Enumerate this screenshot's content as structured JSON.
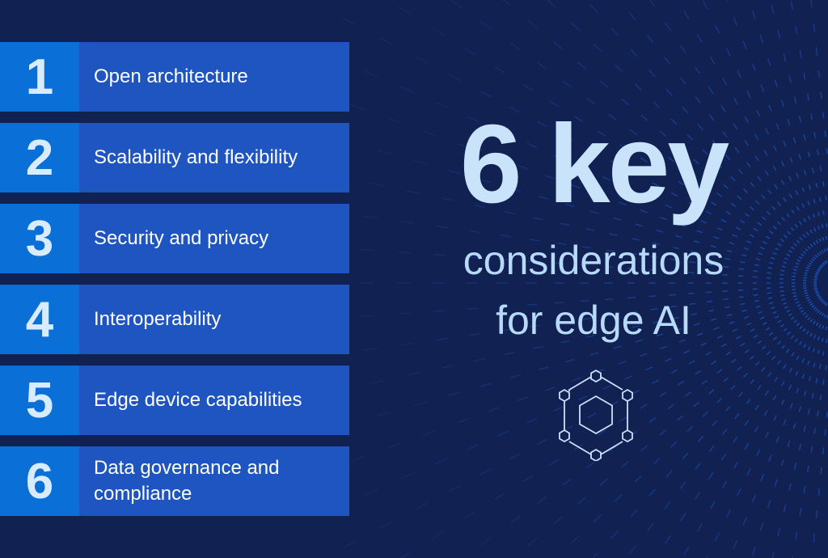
{
  "colors": {
    "background": "#112152",
    "number_block": "#0a6fd6",
    "label_block": "#1e55c0",
    "headline_text": "#c9e3fb",
    "dash_pattern": "#1f62d8"
  },
  "list": {
    "items": [
      {
        "number": "1",
        "label": "Open architecture"
      },
      {
        "number": "2",
        "label": "Scalability and flexibility"
      },
      {
        "number": "3",
        "label": "Security and privacy"
      },
      {
        "number": "4",
        "label": "Interoperability"
      },
      {
        "number": "5",
        "label": "Edge device capabilities"
      },
      {
        "number": "6",
        "label": "Data governance and compliance"
      }
    ]
  },
  "headline": {
    "line1": "6 key",
    "line2": "considerations",
    "line3": "for edge AI"
  },
  "icon": {
    "name": "hexagon-network-icon"
  }
}
